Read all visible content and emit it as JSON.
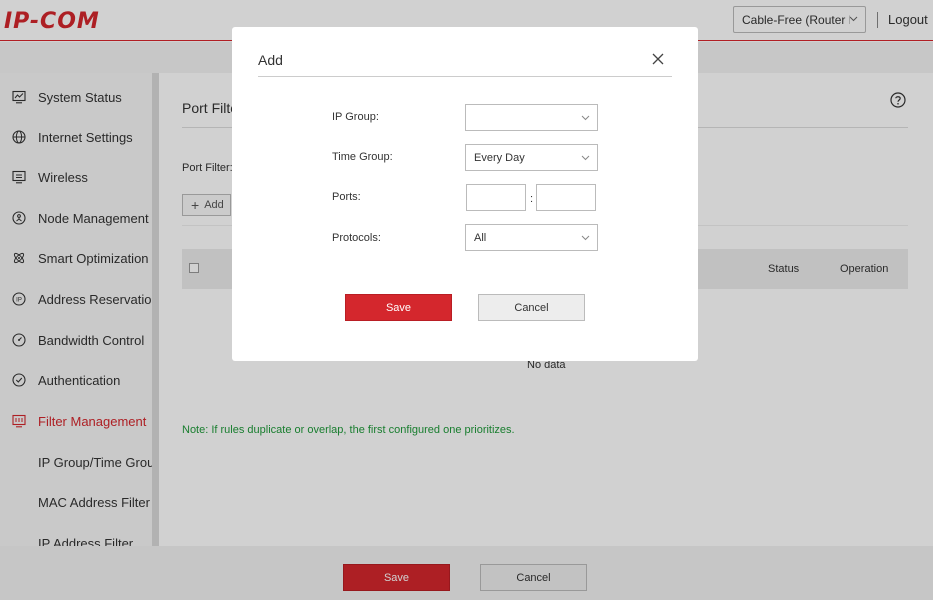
{
  "header": {
    "logo": "IP-COM",
    "mode_select": "Cable-Free (Router M...",
    "logout": "Logout",
    "brand_color": "#d4272d"
  },
  "sidebar": {
    "items": [
      {
        "label": "System Status",
        "icon": "monitor-chart-icon"
      },
      {
        "label": "Internet Settings",
        "icon": "globe-icon"
      },
      {
        "label": "Wireless",
        "icon": "wireless-monitor-icon"
      },
      {
        "label": "Node Management",
        "icon": "node-network-icon"
      },
      {
        "label": "Smart Optimization",
        "icon": "atom-icon"
      },
      {
        "label": "Address Reservation",
        "icon": "ip-address-icon"
      },
      {
        "label": "Bandwidth Control",
        "icon": "gauge-icon"
      },
      {
        "label": "Authentication",
        "icon": "shield-check-icon"
      },
      {
        "label": "Filter Management",
        "icon": "filter-screen-icon",
        "active": true
      },
      {
        "label": "IP Group/Time Group"
      },
      {
        "label": "MAC Address Filter"
      },
      {
        "label": "IP Address Filter"
      }
    ]
  },
  "main": {
    "title": "Port Filte",
    "port_filter_label": "Port Filter:",
    "add_label": "Add",
    "table": {
      "columns": [
        "Status",
        "Operation"
      ],
      "empty_text": "No data"
    },
    "note": "Note: If rules duplicate or overlap, the first configured one prioritizes."
  },
  "footer": {
    "save_label": "Save",
    "cancel_label": "Cancel"
  },
  "modal": {
    "title": "Add",
    "fields": {
      "ip_group_label": "IP Group:",
      "ip_group_value": "",
      "time_group_label": "Time Group:",
      "time_group_value": "Every Day",
      "ports_label": "Ports:",
      "ports_start": "",
      "ports_end": "",
      "ports_separator": ":",
      "protocols_label": "Protocols:",
      "protocols_value": "All"
    },
    "save_label": "Save",
    "cancel_label": "Cancel"
  }
}
